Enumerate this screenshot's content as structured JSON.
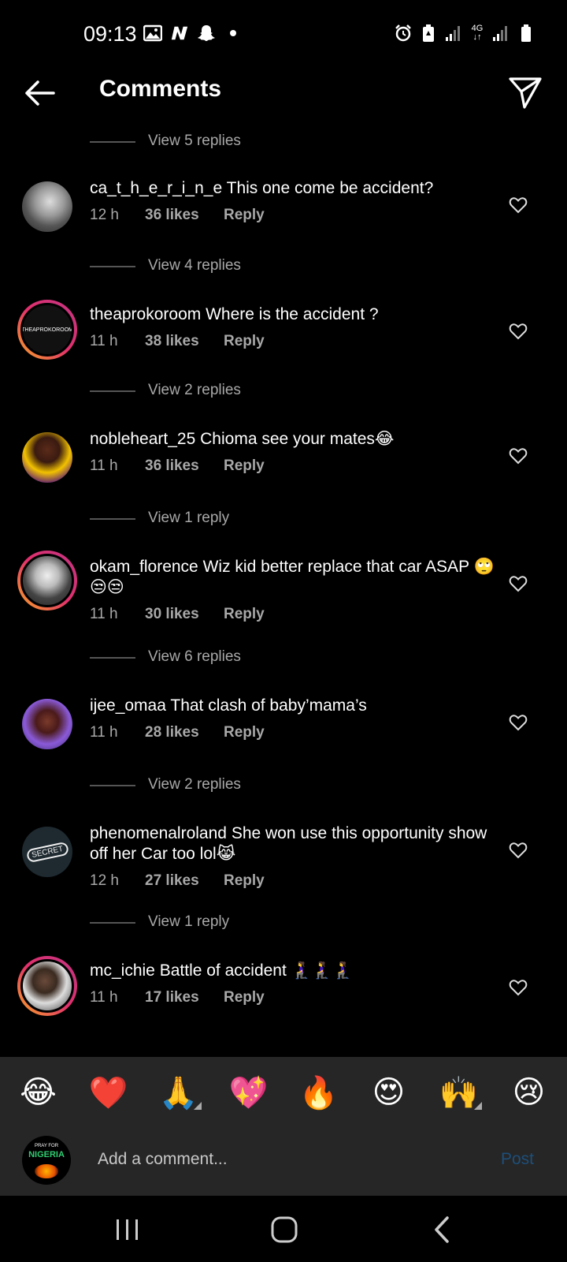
{
  "status_bar": {
    "time": "09:13",
    "left_icons": [
      "gallery-icon",
      "n-app-icon",
      "snapchat-icon"
    ],
    "right_icons": [
      "alarm-icon",
      "battery-saver-icon",
      "signal-icon",
      "network-4g-icon",
      "signal-icon",
      "battery-icon"
    ],
    "network_label": "4G"
  },
  "header": {
    "title": "Comments",
    "back_icon": "arrow-left-icon",
    "send_icon": "paper-plane-icon"
  },
  "comments": [
    {
      "view_replies": "View 5 replies"
    },
    {
      "user": "ca_t_h_e_r_i_n_e",
      "text": "This one come be accident?",
      "time": "12 h",
      "likes": "36 likes",
      "reply": "Reply",
      "ring": false
    },
    {
      "view_replies": "View 4 replies"
    },
    {
      "user": "theaprokoroom",
      "text": "Where is the accident ?",
      "time": "11 h",
      "likes": "38 likes",
      "reply": "Reply",
      "ring": true,
      "avatar_text": "THEAPROKOROOM"
    },
    {
      "view_replies": "View 2 replies"
    },
    {
      "user": "nobleheart_25",
      "text": "Chioma see your mates😂",
      "time": "11 h",
      "likes": "36 likes",
      "reply": "Reply",
      "ring": false
    },
    {
      "view_replies": "View 1 reply"
    },
    {
      "user": "okam_florence",
      "text": "Wiz kid better replace that car ASAP 🙄😒😒",
      "time": "11 h",
      "likes": "30 likes",
      "reply": "Reply",
      "ring": true
    },
    {
      "view_replies": "View 6 replies"
    },
    {
      "user": "ijee_omaa",
      "text": "That clash of baby’mama’s",
      "time": "11 h",
      "likes": "28 likes",
      "reply": "Reply",
      "ring": false
    },
    {
      "view_replies": "View 2 replies"
    },
    {
      "user": "phenomenalroland",
      "text": "She won use this opportunity show off her Car too lol😹",
      "time": "12 h",
      "likes": "27 likes",
      "reply": "Reply",
      "ring": false,
      "avatar_text": "SECRET"
    },
    {
      "view_replies": "View 1 reply"
    },
    {
      "user": "mc_ichie",
      "text": "Battle of accident 🧎‍♀️🧎‍♀️🧎‍♀️",
      "time": "11 h",
      "likes": "17 likes",
      "reply": "Reply",
      "ring": true
    }
  ],
  "emoji_bar": [
    "😂",
    "❤️",
    "🙏",
    "💖",
    "🔥",
    "😍",
    "🙌",
    "😢"
  ],
  "input": {
    "placeholder": "Add a comment...",
    "post_label": "Post",
    "avatar_text_top": "PRAY FOR",
    "avatar_text_main": "NIGERIA"
  },
  "nav_bar": {
    "icons": [
      "recent-apps-icon",
      "home-icon",
      "back-icon"
    ]
  },
  "colors": {
    "background": "#000000",
    "panel": "#262626",
    "secondary_text": "#a8a8a8",
    "post_button": "#1d4f7a",
    "ring_gradient": [
      "#f9a825",
      "#e1306c",
      "#c13584"
    ]
  }
}
